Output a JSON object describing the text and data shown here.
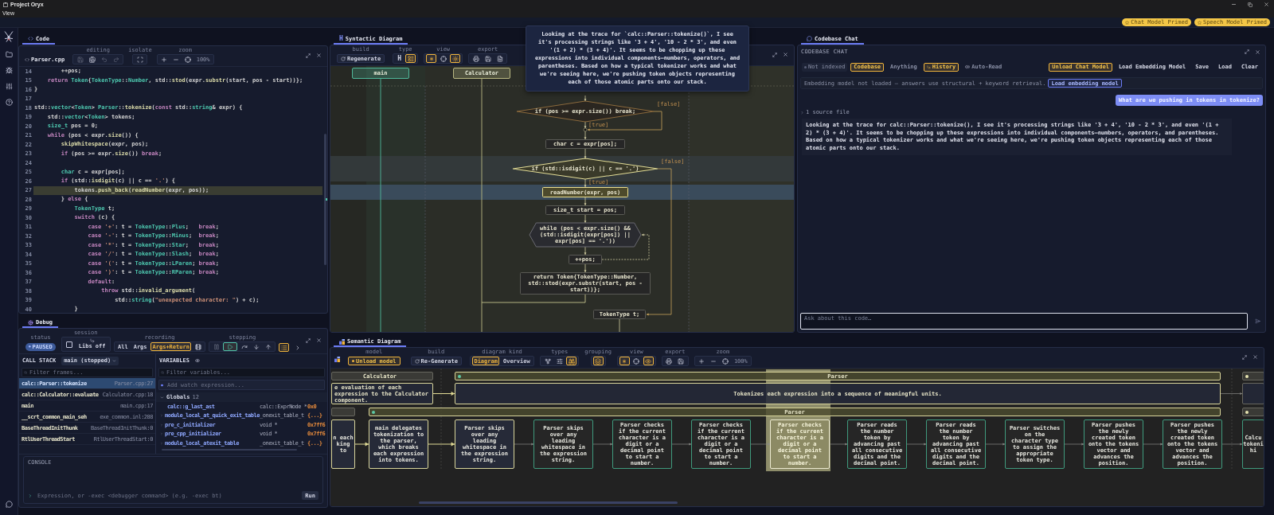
{
  "window": {
    "title": "Project Oryx",
    "menu": [
      "View"
    ]
  },
  "model_badges": [
    {
      "label": "Chat Model Primed"
    },
    {
      "label": "Speech Model Primed"
    }
  ],
  "code_panel": {
    "tab": "Code",
    "file": "Parser.cpp",
    "toolbar": [
      {
        "caption": "editing",
        "items": [
          {
            "kind": "save",
            "on": false,
            "disabled": true
          },
          {
            "kind": "save-as",
            "on": false,
            "disabled": false
          },
          {
            "kind": "undo",
            "on": false,
            "disabled": true
          },
          {
            "kind": "redo",
            "on": false,
            "disabled": true
          }
        ]
      },
      {
        "caption": "isolate",
        "items": [
          {
            "kind": "isolate",
            "on": false
          }
        ]
      },
      {
        "caption": "zoom",
        "items": [
          {
            "kind": "plus",
            "on": false
          },
          {
            "kind": "minus",
            "on": false
          },
          {
            "kind": "crosshair",
            "on": false
          },
          {
            "kind": "readout",
            "label": "100%"
          }
        ]
      }
    ],
    "lines": [
      {
        "number": "14",
        "current": false,
        "tokens": [
          {
            "kind": "plain",
            "text": "        ++pos;"
          }
        ]
      },
      {
        "number": "15",
        "current": false,
        "tokens": [
          {
            "kind": "keyword",
            "text": "    return "
          },
          {
            "kind": "type",
            "text": "Token"
          },
          {
            "kind": "plain",
            "text": "{"
          },
          {
            "kind": "type",
            "text": "TokenType"
          },
          {
            "kind": "plain",
            "text": "::"
          },
          {
            "kind": "type",
            "text": "Number"
          },
          {
            "kind": "plain",
            "text": ", std::"
          },
          {
            "kind": "function",
            "text": "stod"
          },
          {
            "kind": "plain",
            "text": "(expr."
          },
          {
            "kind": "function",
            "text": "substr"
          },
          {
            "kind": "plain",
            "text": "(start, pos - start))};"
          }
        ]
      },
      {
        "number": "16",
        "current": false,
        "tokens": [
          {
            "kind": "plain",
            "text": "}"
          }
        ]
      },
      {
        "number": "17",
        "current": false
      },
      {
        "number": "18",
        "current": false,
        "tokens": [
          {
            "kind": "plain",
            "text": "std::"
          },
          {
            "kind": "type",
            "text": "vector"
          },
          {
            "kind": "plain",
            "text": "<"
          },
          {
            "kind": "type",
            "text": "Token"
          },
          {
            "kind": "plain",
            "text": "> "
          },
          {
            "kind": "type",
            "text": "Parser"
          },
          {
            "kind": "plain",
            "text": "::"
          },
          {
            "kind": "function",
            "text": "tokenize"
          },
          {
            "kind": "plain",
            "text": "("
          },
          {
            "kind": "keyword",
            "text": "const"
          },
          {
            "kind": "plain",
            "text": " std::"
          },
          {
            "kind": "type",
            "text": "string"
          },
          {
            "kind": "plain",
            "text": "& expr) {"
          }
        ]
      },
      {
        "number": "19",
        "current": false,
        "tokens": [
          {
            "kind": "plain",
            "text": "    std::"
          },
          {
            "kind": "type",
            "text": "vector"
          },
          {
            "kind": "plain",
            "text": "<"
          },
          {
            "kind": "type",
            "text": "Token"
          },
          {
            "kind": "plain",
            "text": "> tokens;"
          }
        ]
      },
      {
        "number": "20",
        "current": false,
        "tokens": [
          {
            "kind": "type",
            "text": "    size_t"
          },
          {
            "kind": "plain",
            "text": " pos = 0;"
          }
        ]
      },
      {
        "number": "21",
        "current": false,
        "tokens": [
          {
            "kind": "keyword",
            "text": "    while"
          },
          {
            "kind": "plain",
            "text": " (pos < expr."
          },
          {
            "kind": "function",
            "text": "size"
          },
          {
            "kind": "plain",
            "text": "()) {"
          }
        ]
      },
      {
        "number": "22",
        "current": false,
        "tokens": [
          {
            "kind": "function",
            "text": "        skipWhitespace"
          },
          {
            "kind": "plain",
            "text": "(expr, pos);"
          }
        ]
      },
      {
        "number": "23",
        "current": false,
        "tokens": [
          {
            "kind": "keyword",
            "text": "        if"
          },
          {
            "kind": "plain",
            "text": " (pos >= expr."
          },
          {
            "kind": "function",
            "text": "size"
          },
          {
            "kind": "plain",
            "text": "()) "
          },
          {
            "kind": "keyword",
            "text": "break"
          },
          {
            "kind": "plain",
            "text": ";"
          }
        ]
      },
      {
        "number": "24",
        "current": false
      },
      {
        "number": "25",
        "current": false,
        "tokens": [
          {
            "kind": "type",
            "text": "        char"
          },
          {
            "kind": "plain",
            "text": " c = expr[pos];"
          }
        ]
      },
      {
        "number": "26",
        "current": false,
        "tokens": [
          {
            "kind": "keyword",
            "text": "        if"
          },
          {
            "kind": "plain",
            "text": " (std::"
          },
          {
            "kind": "function",
            "text": "isdigit"
          },
          {
            "kind": "plain",
            "text": "(c) || c == "
          },
          {
            "kind": "string",
            "text": "'.'"
          },
          {
            "kind": "plain",
            "text": ") {"
          }
        ]
      },
      {
        "number": "27",
        "current": true,
        "tokens": [
          {
            "kind": "plain",
            "text": "            tokens."
          },
          {
            "kind": "function",
            "text": "push_back"
          },
          {
            "kind": "plain",
            "text": "("
          },
          {
            "kind": "function",
            "text": "readNumber"
          },
          {
            "kind": "plain",
            "text": "(expr, pos));"
          }
        ]
      },
      {
        "number": "28",
        "current": false,
        "tokens": [
          {
            "kind": "plain",
            "text": "        } "
          },
          {
            "kind": "keyword",
            "text": "else"
          },
          {
            "kind": "plain",
            "text": " {"
          }
        ]
      },
      {
        "number": "29",
        "current": false,
        "tokens": [
          {
            "kind": "type",
            "text": "            TokenType"
          },
          {
            "kind": "plain",
            "text": " t;"
          }
        ]
      },
      {
        "number": "30",
        "current": false,
        "tokens": [
          {
            "kind": "keyword",
            "text": "            switch"
          },
          {
            "kind": "plain",
            "text": " (c) {"
          }
        ]
      },
      {
        "number": "31",
        "current": false,
        "tokens": [
          {
            "kind": "keyword",
            "text": "                case "
          },
          {
            "kind": "string",
            "text": "'+'"
          },
          {
            "kind": "plain",
            "text": ": t = "
          },
          {
            "kind": "type",
            "text": "TokenType"
          },
          {
            "kind": "plain",
            "text": "::"
          },
          {
            "kind": "type",
            "text": "Plus"
          },
          {
            "kind": "plain",
            "text": ";   "
          },
          {
            "kind": "keyword",
            "text": "break"
          },
          {
            "kind": "plain",
            "text": ";"
          }
        ]
      },
      {
        "number": "32",
        "current": false,
        "tokens": [
          {
            "kind": "keyword",
            "text": "                case "
          },
          {
            "kind": "string",
            "text": "'-'"
          },
          {
            "kind": "plain",
            "text": ": t = "
          },
          {
            "kind": "type",
            "text": "TokenType"
          },
          {
            "kind": "plain",
            "text": "::"
          },
          {
            "kind": "type",
            "text": "Minus"
          },
          {
            "kind": "plain",
            "text": ";  "
          },
          {
            "kind": "keyword",
            "text": "break"
          },
          {
            "kind": "plain",
            "text": ";"
          }
        ]
      },
      {
        "number": "33",
        "current": false,
        "tokens": [
          {
            "kind": "keyword",
            "text": "                case "
          },
          {
            "kind": "string",
            "text": "'*'"
          },
          {
            "kind": "plain",
            "text": ": t = "
          },
          {
            "kind": "type",
            "text": "TokenType"
          },
          {
            "kind": "plain",
            "text": "::"
          },
          {
            "kind": "type",
            "text": "Star"
          },
          {
            "kind": "plain",
            "text": ";   "
          },
          {
            "kind": "keyword",
            "text": "break"
          },
          {
            "kind": "plain",
            "text": ";"
          }
        ]
      },
      {
        "number": "34",
        "current": false,
        "tokens": [
          {
            "kind": "keyword",
            "text": "                case "
          },
          {
            "kind": "string",
            "text": "'/'"
          },
          {
            "kind": "plain",
            "text": ": t = "
          },
          {
            "kind": "type",
            "text": "TokenType"
          },
          {
            "kind": "plain",
            "text": "::"
          },
          {
            "kind": "type",
            "text": "Slash"
          },
          {
            "kind": "plain",
            "text": ";  "
          },
          {
            "kind": "keyword",
            "text": "break"
          },
          {
            "kind": "plain",
            "text": ";"
          }
        ]
      },
      {
        "number": "35",
        "current": false,
        "tokens": [
          {
            "kind": "keyword",
            "text": "                case "
          },
          {
            "kind": "string",
            "text": "'('"
          },
          {
            "kind": "plain",
            "text": ": t = "
          },
          {
            "kind": "type",
            "text": "TokenType"
          },
          {
            "kind": "plain",
            "text": "::"
          },
          {
            "kind": "type",
            "text": "LParen"
          },
          {
            "kind": "plain",
            "text": "; "
          },
          {
            "kind": "keyword",
            "text": "break"
          },
          {
            "kind": "plain",
            "text": ";"
          }
        ]
      },
      {
        "number": "36",
        "current": false,
        "tokens": [
          {
            "kind": "keyword",
            "text": "                case "
          },
          {
            "kind": "string",
            "text": "')'"
          },
          {
            "kind": "plain",
            "text": ": t = "
          },
          {
            "kind": "type",
            "text": "TokenType"
          },
          {
            "kind": "plain",
            "text": "::"
          },
          {
            "kind": "type",
            "text": "RParen"
          },
          {
            "kind": "plain",
            "text": "; "
          },
          {
            "kind": "keyword",
            "text": "break"
          },
          {
            "kind": "plain",
            "text": ";"
          }
        ]
      },
      {
        "number": "37",
        "current": false,
        "tokens": [
          {
            "kind": "keyword",
            "text": "                default"
          },
          {
            "kind": "plain",
            "text": ":"
          }
        ]
      },
      {
        "number": "38",
        "current": false,
        "tokens": [
          {
            "kind": "keyword",
            "text": "                    throw"
          },
          {
            "kind": "plain",
            "text": " std::"
          },
          {
            "kind": "function",
            "text": "invalid_argument"
          },
          {
            "kind": "plain",
            "text": "("
          }
        ]
      },
      {
        "number": "39",
        "current": false,
        "tokens": [
          {
            "kind": "plain",
            "text": "                        std::"
          },
          {
            "kind": "type",
            "text": "string"
          },
          {
            "kind": "plain",
            "text": "("
          },
          {
            "kind": "string",
            "text": "\"unexpected character: \""
          },
          {
            "kind": "plain",
            "text": ") + c);"
          }
        ]
      },
      {
        "number": "40",
        "current": false,
        "tokens": [
          {
            "kind": "plain",
            "text": "            }"
          }
        ]
      }
    ]
  },
  "debug_panel": {
    "tab": "Debug",
    "toolbar": [
      {
        "caption": "status",
        "items": [
          {
            "kind": "status",
            "label": "PAUSED"
          }
        ]
      },
      {
        "caption": "session",
        "items": [
          {
            "kind": "checkbox",
            "checked": false
          },
          {
            "kind": "libs",
            "label": "Libs off"
          }
        ]
      },
      {
        "caption": "recording",
        "items": [
          {
            "kind": "text",
            "label": "All",
            "on": false
          },
          {
            "kind": "text",
            "label": "Args",
            "on": false
          },
          {
            "kind": "text",
            "label": "Args+Return",
            "on": true
          },
          {
            "kind": "film",
            "on": false
          }
        ]
      },
      {
        "caption": "stepping",
        "items": [
          {
            "kind": "pause",
            "on": false,
            "disabled": true
          },
          {
            "kind": "continue",
            "on": true,
            "disabled": false
          },
          {
            "kind": "step-over",
            "on": false,
            "disabled": false
          },
          {
            "kind": "step-into",
            "on": false,
            "disabled": false
          },
          {
            "kind": "step-out",
            "on": false,
            "disabled": false
          }
        ]
      }
    ],
    "extra_buttons": [
      {
        "kind": "log",
        "on": true
      },
      {
        "kind": "more",
        "on": false
      }
    ],
    "call_stack": {
      "title": "CALL STACK",
      "thread": "main (stopped)",
      "filter_placeholder": "Filter frames...",
      "frames": [
        {
          "name": "calc::Parser::tokenize",
          "location": "Parser.cpp:27",
          "selected": true
        },
        {
          "name": "calc::Calculator::evaluate",
          "location": "Calculator.cpp:18",
          "selected": false
        },
        {
          "name": "main",
          "location": "main.cpp:17",
          "selected": false
        },
        {
          "name": "__scrt_common_main_seh",
          "location": "exe_common.inl:288",
          "selected": false
        },
        {
          "name": "BaseThreadInitThunk",
          "location": "BaseThreadInitThunk:0",
          "selected": false
        },
        {
          "name": "RtlUserThreadStart",
          "location": "RtlUserThreadStart:0",
          "selected": false
        }
      ]
    },
    "variables": {
      "title": "VARIABLES",
      "filter_placeholder": "Filter variables...",
      "watch_placeholder": "Add watch expression...",
      "scope": {
        "name": "Globals",
        "count": "12",
        "expanded": true
      },
      "items": [
        {
          "name": "calc::g_last_ast",
          "type": "calc::ExprNode *",
          "value": "0x0",
          "expandable": false
        },
        {
          "name": "module_local_at_quick_exit_table",
          "type": "_onexit_table_t",
          "value": "{...}",
          "expandable": true
        },
        {
          "name": "pre_c_initializer",
          "type": "void *",
          "value": "0x7ff6",
          "expandable": true
        },
        {
          "name": "pre_cpp_initializer",
          "type": "void *",
          "value": "0x7ff6",
          "expandable": true
        },
        {
          "name": "module_local_atexit_table",
          "type": "_onexit_table_t",
          "value": "{...}",
          "expandable": true
        }
      ]
    },
    "console": {
      "title": "CONSOLE",
      "placeholder": "Expression, or -exec <debugger command> (e.g. -exec bt)",
      "run": "Run"
    }
  },
  "syntactic_panel": {
    "tab_icon": "H",
    "tab": "Syntactic Diagram",
    "toolbar": [
      {
        "caption": "build",
        "items": [
          {
            "kind": "regenerate",
            "label": "Regenerate",
            "on": false
          }
        ]
      },
      {
        "caption": "type",
        "items": [
          {
            "kind": "glyph",
            "label": "H",
            "on": false
          },
          {
            "kind": "box",
            "on": true
          }
        ]
      },
      {
        "caption": "view",
        "items": [
          {
            "kind": "asterisk",
            "on": true
          },
          {
            "kind": "crosshair",
            "on": false
          },
          {
            "kind": "sun",
            "on": true
          }
        ]
      },
      {
        "caption": "export",
        "items": [
          {
            "kind": "print",
            "on": false
          },
          {
            "kind": "save",
            "on": false
          },
          {
            "kind": "document",
            "on": false
          }
        ]
      }
    ],
    "lanes": [
      {
        "label": "main",
        "color": "#4fb89a"
      },
      {
        "label": "Calculator",
        "color": "#b9b882"
      }
    ],
    "nodes": [
      {
        "kind": "decision",
        "text": "if (pos >= expr.size()) break;",
        "true_label": "[true]",
        "false_label": "[false]",
        "traced": false,
        "current": false
      },
      {
        "kind": "process",
        "text": "char c = expr[pos];",
        "traced": false,
        "current": false
      },
      {
        "kind": "decision",
        "text": "if (std::isdigit(c) || c == '.')",
        "true_label": "[true]",
        "false_label": "[false]",
        "traced": true,
        "current": false
      },
      {
        "kind": "process",
        "text": "readNumber(expr, pos)",
        "traced": true,
        "current": true
      },
      {
        "kind": "process",
        "text": "size_t start = pos;",
        "traced": false,
        "current": false
      },
      {
        "kind": "loop",
        "text": "while (pos < expr.size() && (std::isdigit(expr[pos]) || expr[pos] == '.'))",
        "traced": false,
        "current": false
      },
      {
        "kind": "process",
        "text": "++pos;",
        "traced": false,
        "current": false
      },
      {
        "kind": "process",
        "text": "return Token{TokenType::Number, std::stod(expr.substr(start, pos - start))};",
        "traced": false,
        "current": false
      },
      {
        "kind": "process",
        "text": "TokenType t;",
        "traced": false,
        "current": false
      }
    ]
  },
  "tooltip": {
    "text": "Looking at the trace for `calc::Parser::tokenize()`, I see it's processing strings like '3 + 4', '10 - 2 * 3', and even '(1 + 2) * (3 + 4)'. It seems to be chopping up these expressions into individual components—numbers, operators, and parentheses. Based on how a typical tokenizer works and what we're seeing here, we're pushing token objects representing each of those atomic parts onto our stack."
  },
  "chat_panel": {
    "tab": "Codebase Chat",
    "title": "CODEBASE CHAT",
    "index_status": "Not indexed",
    "scopes": [
      {
        "label": "Codebase",
        "selected": true
      },
      {
        "label": "Anything",
        "selected": false
      }
    ],
    "history": {
      "label": "History",
      "on": true
    },
    "auto_read": {
      "label": "Auto-Read",
      "on": false
    },
    "actions": [
      {
        "label": "Unload Chat Model",
        "on": true
      },
      {
        "label": "Load Embedding Model",
        "on": false
      },
      {
        "label": "Save",
        "on": false
      },
      {
        "label": "Load",
        "on": false
      },
      {
        "label": "Clear",
        "on": false
      }
    ],
    "notice": {
      "text": "Embedding model not loaded — answers use structural + keyword retrieval.",
      "action": "Load embedding model"
    },
    "messages": [
      {
        "kind": "user",
        "text": "What are we pushing in tokens in tokenize?"
      },
      {
        "kind": "assistant",
        "sources": "1 source file",
        "text": "Looking at the trace for calc::Parser::tokenize(), I see it's processing strings like '3 + 4', '10 - 2 * 3', and even '(1 + 2) * (3 + 4)'. It seems to be chopping up these expressions into individual components—numbers, operators, and parentheses. Based on how a typical tokenizer works and what we're seeing here, we're pushing token objects representing each of those atomic parts onto our stack."
      }
    ],
    "input": {
      "placeholder": "Ask about this code…"
    }
  },
  "semantic_panel": {
    "tab": "Semantic Diagram",
    "toolbar": [
      {
        "caption": "model",
        "items": [
          {
            "kind": "unload",
            "label": "Unload model",
            "on": true
          }
        ]
      },
      {
        "caption": "build",
        "items": [
          {
            "kind": "regenerate",
            "label": "Re-Generate",
            "on": false
          }
        ]
      },
      {
        "caption": "diagram kind",
        "items": [
          {
            "kind": "text",
            "label": "Diagram",
            "on": true
          },
          {
            "kind": "text",
            "label": "Overview",
            "on": false
          }
        ]
      },
      {
        "caption": "types",
        "items": [
          {
            "kind": "fork",
            "on": false
          },
          {
            "kind": "sliders",
            "on": false
          },
          {
            "kind": "binoculars",
            "on": true
          }
        ]
      },
      {
        "caption": "grouping",
        "items": [
          {
            "kind": "stack",
            "on": true
          }
        ]
      },
      {
        "caption": "view",
        "items": [
          {
            "kind": "asterisk",
            "on": true
          },
          {
            "kind": "crosshair",
            "on": false
          },
          {
            "kind": "eye",
            "on": true
          }
        ]
      },
      {
        "caption": "export",
        "items": [
          {
            "kind": "print",
            "on": false
          },
          {
            "kind": "save",
            "on": false
          }
        ]
      },
      {
        "caption": "zoom",
        "items": [
          {
            "kind": "plus",
            "on": false
          },
          {
            "kind": "minus",
            "on": false
          },
          {
            "kind": "crosshair",
            "on": false
          },
          {
            "kind": "readout",
            "label": "100%"
          }
        ]
      }
    ],
    "groups": [
      {
        "title": "Calculator",
        "summary": "e evaluation of each expression to the Calculator component.",
        "traced": true
      },
      {
        "title": "Parser",
        "summary": "Tokenizes each expression into a sequence of meaningful units.",
        "color": "#5ec9a6",
        "traced": true
      },
      {
        "color": "#e6e3b0",
        "traced": false
      }
    ],
    "lanes": [
      {
        "traced": false
      },
      {
        "title": "Parser",
        "color": "#5ec9a6",
        "traced": true
      },
      {
        "color": "#e6e3b0",
        "traced": false
      }
    ],
    "steps": [
      {
        "text": "n each king to",
        "traced": true,
        "selected": false
      },
      {
        "text": "main delegates tokenization to the parser, which breaks each expression into tokens.",
        "traced": true,
        "selected": false
      },
      {
        "text": "Parser skips over any leading whitespace in the expression string.",
        "traced": true,
        "selected": false
      },
      {
        "text": "Parser skips over any leading whitespace in the expression string.",
        "traced": false,
        "selected": false
      },
      {
        "text": "Parser checks if the current character is a digit or a decimal point to start a number.",
        "traced": false,
        "selected": false
      },
      {
        "text": "Parser checks if the current character is a digit or a decimal point to start a number.",
        "traced": false,
        "selected": false
      },
      {
        "text": "Parser checks if the current character is a digit or a decimal point to start a number.",
        "traced": false,
        "selected": true
      },
      {
        "text": "Parser reads the number token by advancing past all consecutive digits and the decimal point.",
        "traced": false,
        "selected": false
      },
      {
        "text": "Parser reads the number token by advancing past all consecutive digits and the decimal point.",
        "traced": false,
        "selected": false
      },
      {
        "text": "Parser switches on the character type to assign the appropriate token type.",
        "traced": false,
        "selected": false
      },
      {
        "text": "Parser pushes the newly created token onto the tokens vector and advances the position.",
        "traced": false,
        "selected": false
      },
      {
        "text": "Parser pushes the newly created token onto the tokens vector and advances the position.",
        "traced": false,
        "selected": false
      },
      {
        "text": "Calcu tokeni hi",
        "traced": false,
        "selected": false
      }
    ]
  }
}
